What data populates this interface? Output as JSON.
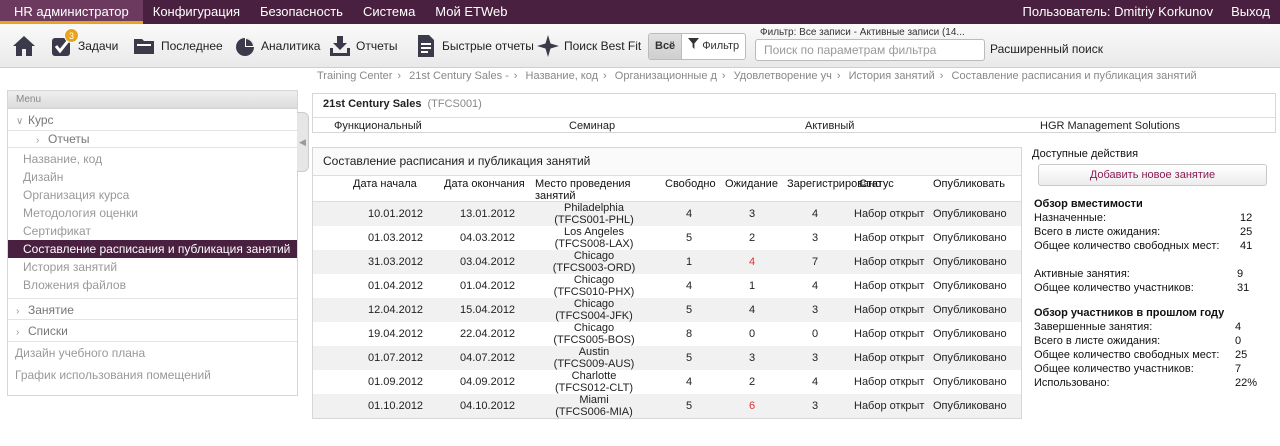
{
  "topbar": {
    "nav": [
      "HR администратор",
      "Конфигурация",
      "Безопасность",
      "Система",
      "Мой ETWeb"
    ],
    "user_label": "Пользователь: Dmitriy Korkunov",
    "logout_label": "Выход"
  },
  "toolbar": {
    "tasks_label": "Задачи",
    "tasks_badge": "3",
    "recent_label": "Последнее",
    "analytics_label": "Аналитика",
    "reports_label": "Отчеты",
    "quick_reports_label": "Быстрые отчеты",
    "bestfit_label": "Поиск Best Fit",
    "all_label": "Всё",
    "filter_label": "Фильтр",
    "filter_caption": "Фильтр: Все записи - Активные записи (14...",
    "search_placeholder": "Поиск по параметрам фильтра",
    "advanced_search_label": "Расширенный поиск",
    "accent_color": "#e7a41e",
    "brand_color": "#4a2040"
  },
  "breadcrumb": [
    "Training Center",
    "21st Century Sales -",
    "Название, код",
    "Организационные д",
    "Удовлетворение уч",
    "История занятий",
    "Составление расписания и публикация занятий"
  ],
  "sidebar": {
    "header": "Menu",
    "course_label": "Курс",
    "reports_label": "Отчеты",
    "items": [
      "Название, код",
      "Дизайн",
      "Организация курса",
      "Методология оценки",
      "Сертификат",
      "Составление расписания и публикация занятий",
      "История занятий",
      "Вложения файлов"
    ],
    "active_index": 5,
    "session_label": "Занятие",
    "lists_label": "Списки",
    "curriculum_label": "Дизайн учебного плана",
    "rooms_label": "График использования помещений"
  },
  "course": {
    "title": "21st Century Sales",
    "code": "(TFCS001)",
    "props": [
      "Функциональный",
      "Семинар",
      "Активный",
      "HGR Management Solutions"
    ]
  },
  "schedule": {
    "title": "Составление расписания и публикация занятий",
    "columns": [
      "Дата начала",
      "Дата окончания",
      "Место проведения занятий",
      "Свободно",
      "Ожидание",
      "Зарегистрировано",
      "Статус",
      "Опубликовать"
    ],
    "rows": [
      {
        "start": "10.01.2012",
        "end": "13.01.2012",
        "city": "Philadelphia",
        "code": "(TFCS001-PHL)",
        "free": "4",
        "wait": "3",
        "reg": "4",
        "status": "Набор открыт",
        "pub": "Опубликовано",
        "wait_alert": false
      },
      {
        "start": "01.03.2012",
        "end": "04.03.2012",
        "city": "Los Angeles",
        "code": "(TFCS008-LAX)",
        "free": "5",
        "wait": "2",
        "reg": "3",
        "status": "Набор открыт",
        "pub": "Опубликовано",
        "wait_alert": false
      },
      {
        "start": "31.03.2012",
        "end": "03.04.2012",
        "city": "Chicago",
        "code": "(TFCS003-ORD)",
        "free": "1",
        "wait": "4",
        "reg": "7",
        "status": "Набор открыт",
        "pub": "Опубликовано",
        "wait_alert": true
      },
      {
        "start": "01.04.2012",
        "end": "01.04.2012",
        "city": "Chicago",
        "code": "(TFCS010-PHX)",
        "free": "4",
        "wait": "1",
        "reg": "4",
        "status": "Набор открыт",
        "pub": "Опубликовано",
        "wait_alert": false
      },
      {
        "start": "12.04.2012",
        "end": "15.04.2012",
        "city": "Chicago",
        "code": "(TFCS004-JFK)",
        "free": "5",
        "wait": "4",
        "reg": "3",
        "status": "Набор открыт",
        "pub": "Опубликовано",
        "wait_alert": false
      },
      {
        "start": "19.04.2012",
        "end": "22.04.2012",
        "city": "Chicago",
        "code": "(TFCS005-BOS)",
        "free": "8",
        "wait": "0",
        "reg": "0",
        "status": "Набор открыт",
        "pub": "Опубликовано",
        "wait_alert": false
      },
      {
        "start": "01.07.2012",
        "end": "04.07.2012",
        "city": "Austin",
        "code": "(TFCS009-AUS)",
        "free": "5",
        "wait": "3",
        "reg": "3",
        "status": "Набор открыт",
        "pub": "Опубликовано",
        "wait_alert": false
      },
      {
        "start": "01.09.2012",
        "end": "04.09.2012",
        "city": "Charlotte",
        "code": "(TFCS012-CLT)",
        "free": "4",
        "wait": "2",
        "reg": "4",
        "status": "Набор открыт",
        "pub": "Опубликовано",
        "wait_alert": false
      },
      {
        "start": "01.10.2012",
        "end": "04.10.2012",
        "city": "Miami",
        "code": "(TFCS006-MIA)",
        "free": "5",
        "wait": "6",
        "reg": "3",
        "status": "Набор открыт",
        "pub": "Опубликовано",
        "wait_alert": true
      }
    ],
    "alert_color": "#dd3333"
  },
  "actions": {
    "title": "Доступные действия",
    "add_label": "Добавить новое занятие",
    "capacity_title": "Обзор вместимости",
    "capacity": [
      {
        "label": "Назначенные:",
        "value": "12"
      },
      {
        "label": "Всего в листе ожидания:",
        "value": "25"
      },
      {
        "label": "Общее количество свободных мест:",
        "value": "41"
      }
    ],
    "sessions": [
      {
        "label": "Активные занятия:",
        "value": "9"
      },
      {
        "label": "Общее количество участников:",
        "value": "31"
      }
    ],
    "lastyear_title": "Обзор участников в прошлом году",
    "lastyear": [
      {
        "label": "Завершенные занятия:",
        "value": "4"
      },
      {
        "label": "Всего в листе ожидания:",
        "value": "0"
      },
      {
        "label": "Общее количество свободных мест:",
        "value": "25"
      },
      {
        "label": "Общее количество участников:",
        "value": "7"
      },
      {
        "label": "Использовано:",
        "value": "22%"
      }
    ]
  }
}
